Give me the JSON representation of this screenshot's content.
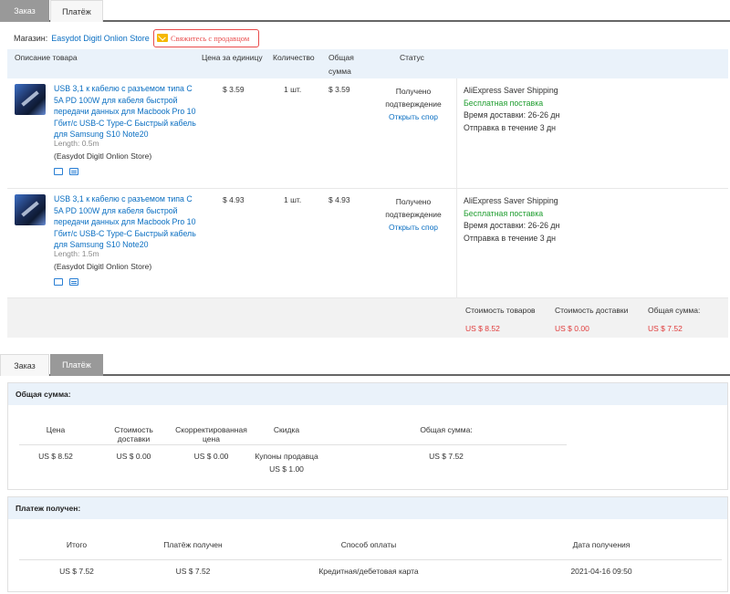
{
  "tabs": {
    "order": "Заказ",
    "payment": "Платёж"
  },
  "store": {
    "label": "Магазин:",
    "name": "Easydot Digitl Onlion Store",
    "contact": "Свяжитесь с продавцом"
  },
  "order_table": {
    "headers": {
      "description": "Описание товара",
      "unit_price": "Цена за единицу",
      "quantity": "Количество",
      "total_line1": "Общая",
      "total_line2": "сумма",
      "status": "Статус"
    },
    "items": [
      {
        "title": "USB 3,1 к кабелю с разъемом типа C 5A PD 100W для кабеля быстрой передачи данных для Macbook Pro 10 Гбит/с USB-C Type-C Быстрый кабель для Samsung S10 Note20",
        "length": "Length: 0.5m",
        "store": "(Easydot Digitl Onlion Store)",
        "price": "$ 3.59",
        "qty": "1 шт.",
        "total": "$ 3.59",
        "status_line1": "Получено",
        "status_line2": "подтверждение",
        "dispute": "Открыть спор",
        "shipping": "AliExpress Saver Shipping",
        "free": "Бесплатная поставка",
        "delivery": "Время доставки: 26-26 дн",
        "dispatch": "Отправка в течение 3 дн"
      },
      {
        "title": "USB 3,1 к кабелю с разъемом типа C 5A PD 100W для кабеля быстрой передачи данных для Macbook Pro 10 Гбит/с USB-C Type-C Быстрый кабель для Samsung S10 Note20",
        "length": "Length: 1.5m",
        "store": "(Easydot Digitl Onlion Store)",
        "price": "$ 4.93",
        "qty": "1 шт.",
        "total": "$ 4.93",
        "status_line1": "Получено",
        "status_line2": "подтверждение",
        "dispute": "Открыть спор",
        "shipping": "AliExpress Saver Shipping",
        "free": "Бесплатная поставка",
        "delivery": "Время доставки: 26-26 дн",
        "dispatch": "Отправка в течение 3 дн"
      }
    ]
  },
  "totals": {
    "goods_label": "Стоимость товаров",
    "goods_value": "US $ 8.52",
    "shipping_label": "Стоимость доставки",
    "shipping_value": "US $ 0.00",
    "sum_label": "Общая сумма:",
    "sum_value": "US $ 7.52"
  },
  "summary_panel": {
    "title": "Общая сумма:",
    "headers": {
      "price": "Цена",
      "delivery_1": "Стоимость",
      "delivery_2": "доставки",
      "adjusted_1": "Скорректированная",
      "adjusted_2": "цена",
      "discount": "Скидка",
      "total": "Общая сумма:"
    },
    "values": {
      "price": "US $ 8.52",
      "delivery": "US $ 0.00",
      "adjusted": "US $ 0.00",
      "discount_1": "Купоны продавца",
      "discount_2": "US $ 1.00",
      "total": "US $ 7.52"
    }
  },
  "payment_panel": {
    "title": "Платеж получен:",
    "headers": {
      "total": "Итого",
      "received": "Платёж получен",
      "method": "Способ оплаты",
      "date": "Дата получения"
    },
    "values": {
      "total": "US $ 7.52",
      "received": "US $ 7.52",
      "method": "Кредитная/дебетовая карта",
      "date": "2021-04-16 09:50"
    }
  },
  "colors": {
    "link": "#0b6fc2",
    "free": "#1f9d2f",
    "red": "#e03b3b",
    "header_bg": "#eaf2fa"
  }
}
